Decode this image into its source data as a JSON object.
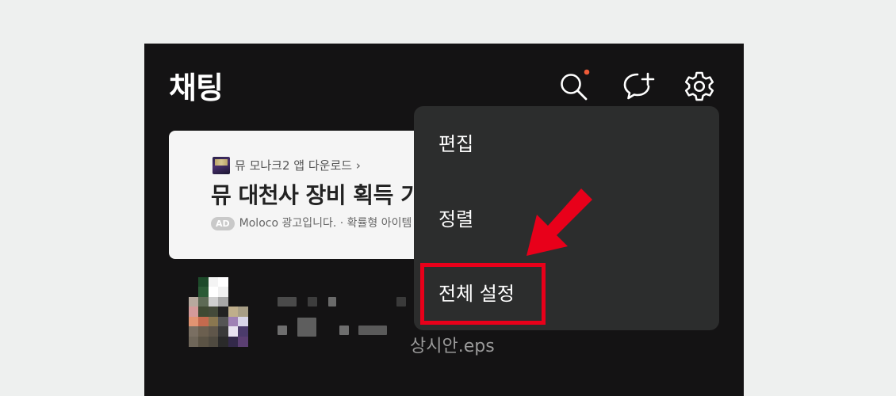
{
  "header": {
    "title": "채팅",
    "icons": [
      "search-icon",
      "new-chat-icon",
      "settings-icon"
    ],
    "notification_dot_color": "#ef5b38"
  },
  "ad": {
    "source_label": "뮤 모나크2 앱 다운로드 ›",
    "headline": "뮤 대천사 장비 획득 기",
    "badge": "AD",
    "sub_text": "Moloco 광고입니다. · 확률형 아이템"
  },
  "chat_row": {
    "file_name": "상시안.eps"
  },
  "menu": {
    "items": [
      {
        "label": "편집"
      },
      {
        "label": "정렬"
      },
      {
        "label": "전체 설정"
      }
    ],
    "highlight_color": "#e8001a"
  },
  "colors": {
    "background": "#eef0ef",
    "app_background": "#141314",
    "menu_background": "#2c2d2d"
  }
}
